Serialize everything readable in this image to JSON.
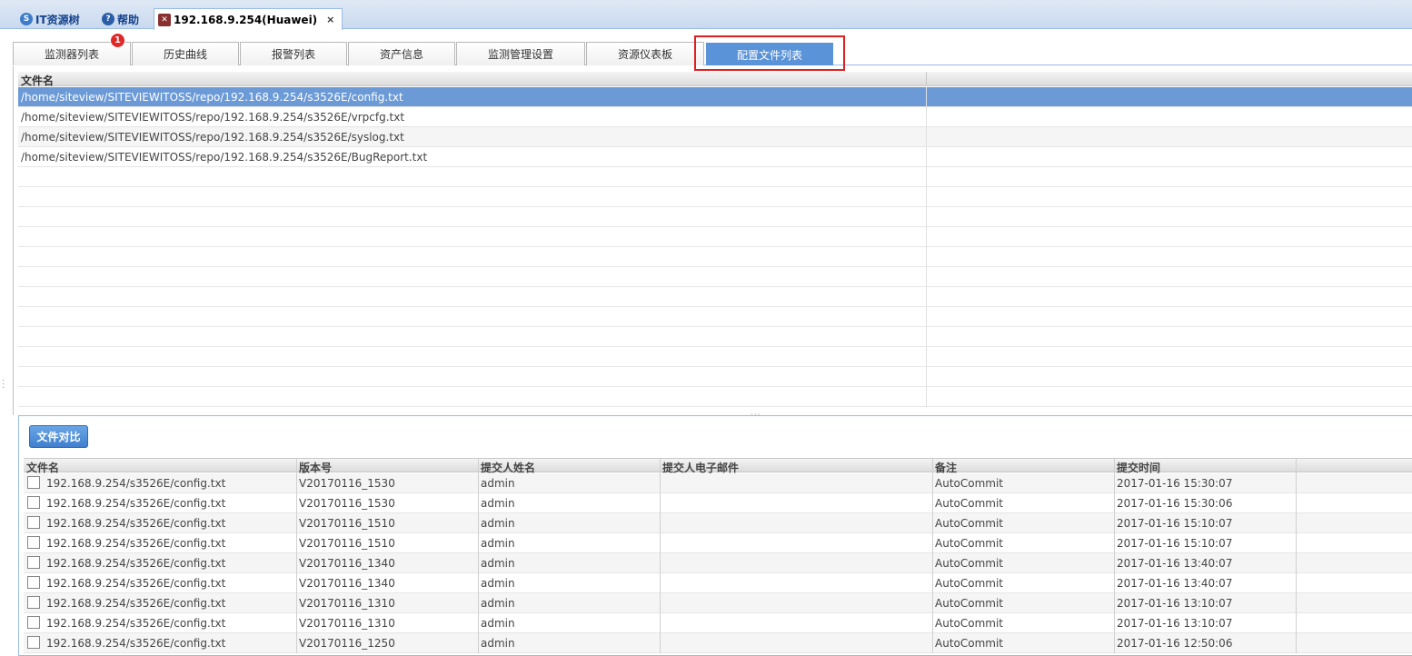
{
  "window_tabs": [
    {
      "label": "IT资源树",
      "icon": "resource-tree-icon"
    },
    {
      "label": "帮助",
      "icon": "help-icon"
    },
    {
      "label": "192.168.9.254(Huawei)",
      "icon": "device-icon",
      "close": "×"
    }
  ],
  "sub_tabs": [
    "监测器列表",
    "历史曲线",
    "报警列表",
    "资产信息",
    "监测管理设置",
    "资源仪表板",
    "配置文件列表"
  ],
  "badge_count": "1",
  "file_list": {
    "header": "文件名",
    "rows": [
      "/home/siteview/SITEVIEWITOSS/repo/192.168.9.254/s3526E/config.txt",
      "/home/siteview/SITEVIEWITOSS/repo/192.168.9.254/s3526E/vrpcfg.txt",
      "/home/siteview/SITEVIEWITOSS/repo/192.168.9.254/s3526E/syslog.txt",
      "/home/siteview/SITEVIEWITOSS/repo/192.168.9.254/s3526E/BugReport.txt"
    ]
  },
  "compare_button": "文件对比",
  "versions": {
    "headers": [
      "文件名",
      "版本号",
      "提交人姓名",
      "提交人电子邮件",
      "备注",
      "提交时间"
    ],
    "rows": [
      [
        "192.168.9.254/s3526E/config.txt",
        "V20170116_1530",
        "admin",
        "",
        "AutoCommit",
        "2017-01-16 15:30:07"
      ],
      [
        "192.168.9.254/s3526E/config.txt",
        "V20170116_1530",
        "admin",
        "",
        "AutoCommit",
        "2017-01-16 15:30:06"
      ],
      [
        "192.168.9.254/s3526E/config.txt",
        "V20170116_1510",
        "admin",
        "",
        "AutoCommit",
        "2017-01-16 15:10:07"
      ],
      [
        "192.168.9.254/s3526E/config.txt",
        "V20170116_1510",
        "admin",
        "",
        "AutoCommit",
        "2017-01-16 15:10:07"
      ],
      [
        "192.168.9.254/s3526E/config.txt",
        "V20170116_1340",
        "admin",
        "",
        "AutoCommit",
        "2017-01-16 13:40:07"
      ],
      [
        "192.168.9.254/s3526E/config.txt",
        "V20170116_1340",
        "admin",
        "",
        "AutoCommit",
        "2017-01-16 13:40:07"
      ],
      [
        "192.168.9.254/s3526E/config.txt",
        "V20170116_1310",
        "admin",
        "",
        "AutoCommit",
        "2017-01-16 13:10:07"
      ],
      [
        "192.168.9.254/s3526E/config.txt",
        "V20170116_1310",
        "admin",
        "",
        "AutoCommit",
        "2017-01-16 13:10:07"
      ],
      [
        "192.168.9.254/s3526E/config.txt",
        "V20170116_1250",
        "admin",
        "",
        "AutoCommit",
        "2017-01-16 12:50:06"
      ]
    ]
  },
  "colors": {
    "accent": "#5b93d8",
    "selected_row": "#6b9ad7",
    "highlight": "#e02020",
    "badge": "#e02828"
  }
}
